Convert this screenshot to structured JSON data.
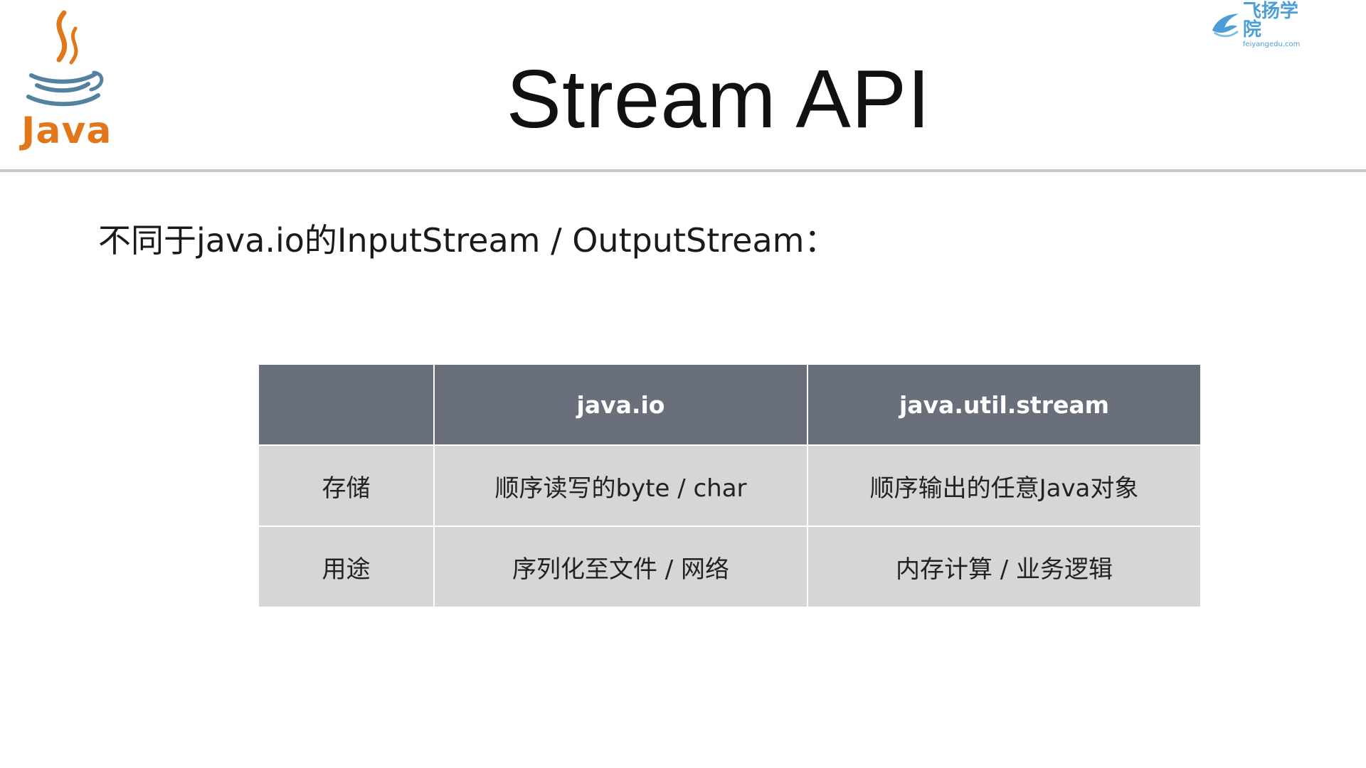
{
  "logo": {
    "java_word": "Java",
    "java_logo_icon": "java-cup-icon"
  },
  "brand": {
    "name": "飞扬学院",
    "url": "feiyangedu.com",
    "icon": "bird-icon",
    "color": "#4a9fd8"
  },
  "title": "Stream API",
  "subtitle": "不同于java.io的InputStream / OutputStream：",
  "table": {
    "headers": [
      "",
      "java.io",
      "java.util.stream"
    ],
    "rows": [
      [
        "存储",
        "顺序读写的byte / char",
        "顺序输出的任意Java对象"
      ],
      [
        "用途",
        "序列化至文件 / 网络",
        "内存计算 / 业务逻辑"
      ]
    ],
    "header_color": "#6a707b",
    "cell_color": "#d6d6d6"
  },
  "colors": {
    "java_orange": "#e2761b",
    "java_blue": "#5382a1",
    "rule": "#c8c8c8"
  }
}
